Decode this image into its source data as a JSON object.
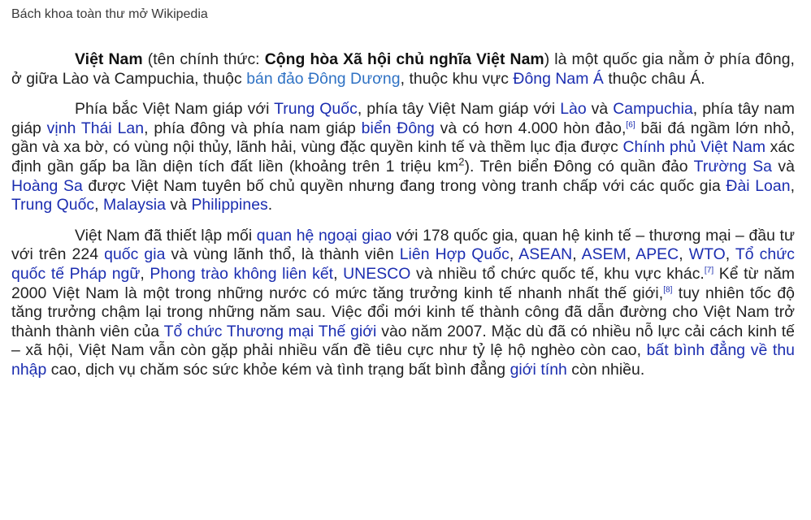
{
  "tagline": "Bách khoa toàn thư mở Wikipedia",
  "p1": {
    "bold_name": "Việt Nam",
    "t1": " (tên chính thức: ",
    "bold_official": "Cộng hòa Xã hội chủ nghĩa Việt Nam",
    "t2": ") là một quốc gia nằm ở phía đông, ở giữa Lào và Campuchia, thuộc ",
    "l1": "bán đảo Đông Dương",
    "t3": ", thuộc khu vực ",
    "l2": "Đông Nam Á",
    "t4": " thuộc châu Á."
  },
  "p2": {
    "t1": "Phía bắc Việt Nam giáp với ",
    "l1": "Trung Quốc",
    "t2": ", phía tây Việt Nam giáp với ",
    "l2": "Lào",
    "t3": " và ",
    "l3": "Campuchia",
    "t4": ", phía tây nam giáp ",
    "l4": "vịnh Thái Lan",
    "t5": ", phía đông và phía nam giáp ",
    "l5": "biển Đông",
    "t6": " và có hơn 4.000 hòn đảo,",
    "ref1": "[6]",
    "t7": " bãi đá ngầm lớn nhỏ, gần và xa bờ, có vùng nội thủy, lãnh hải, vùng đặc quyền kinh tế và thềm lục địa được ",
    "l6": "Chính phủ Việt Nam",
    "t8": " xác định gần gấp ba lần diện tích đất liền (khoảng trên 1 triệu km",
    "sq": "2",
    "t9": "). Trên biển Đông có quần đảo ",
    "l7": "Trường Sa",
    "t10": " và ",
    "l8": "Hoàng Sa",
    "t11": " được Việt Nam tuyên bố chủ quyền nhưng đang trong vòng tranh chấp với các quốc gia ",
    "l9": "Đài Loan",
    "t12": ", ",
    "l10": "Trung Quốc",
    "t13": ", ",
    "l11": "Malaysia",
    "t14": " và ",
    "l12": "Philippines",
    "t15": "."
  },
  "p3": {
    "t1": "Việt Nam đã thiết lập mối ",
    "l1": "quan hệ ngoại giao",
    "t2": " với 178 quốc gia, quan hệ kinh tế – thương mại – đầu tư với trên 224 ",
    "l2": "quốc gia",
    "t3": " và vùng lãnh thổ, là thành viên ",
    "l3": "Liên Hợp Quốc",
    "t4": ", ",
    "l4": "ASEAN",
    "t5": ", ",
    "l5": "ASEM",
    "t6": ", ",
    "l6": "APEC",
    "t7": ", ",
    "l7": "WTO",
    "t8": ", ",
    "l8": "Tổ chức quốc tế Pháp ngữ",
    "t9": ", ",
    "l9": "Phong trào không liên kết",
    "t10": ", ",
    "l10": "UNESCO",
    "t11": " và nhiều tổ chức quốc tế, khu vực khác.",
    "ref1": "[7]",
    "t12": " Kể từ năm 2000 Việt Nam là một trong những nước có mức tăng trưởng kinh tế nhanh nhất thế giới,",
    "ref2": "[8]",
    "t13": " tuy nhiên tốc độ tăng trưởng chậm lại trong những năm sau. Việc đổi mới kinh tế thành công đã dẫn đường cho Việt Nam trở thành thành viên của ",
    "l11": "Tổ chức Thương mại Thế giới",
    "t14": " vào năm 2007. Mặc dù đã có nhiều nỗ lực cải cách kinh tế – xã hội, Việt Nam vẫn còn gặp phải nhiều vấn đề tiêu cực như tỷ lệ hộ nghèo còn cao, ",
    "l12": "bất bình đẳng về thu nhập",
    "t15": " cao, dịch vụ chăm sóc sức khỏe kém và tình trạng bất bình đẳng ",
    "l13": "giới tính",
    "t16": " còn nhiều."
  },
  "colors": {
    "link": "#1b2db0",
    "link_light": "#2f72c4",
    "text": "#222222"
  }
}
